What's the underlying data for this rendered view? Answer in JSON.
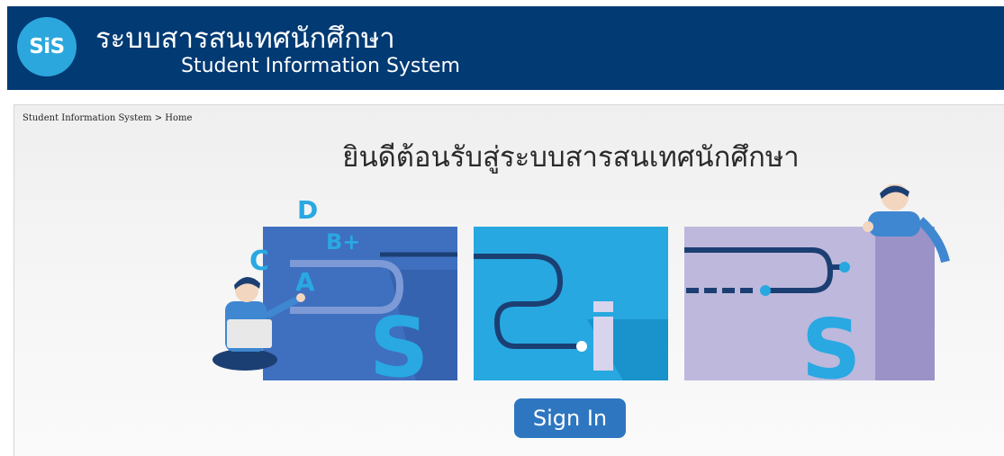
{
  "header": {
    "logo_text": "SiS",
    "title_th": "ระบบสารสนเทศนักศึกษา",
    "title_en": "Student Information System"
  },
  "breadcrumb": "Student Information System > Home",
  "welcome": "ยินดีต้อนรับสู่ระบบสารสนเทศนักศึกษา",
  "banner": {
    "grades": [
      "D",
      "C",
      "B+",
      "A"
    ],
    "colors": {
      "blue_panel": "#3f6fbf",
      "cyan_panel": "#27a8e0",
      "lavender_panel": "#bdb8dc",
      "navy": "#1c3f73"
    }
  },
  "signin_label": "Sign In",
  "colors": {
    "header_bg": "#023a73",
    "button": "#2f76c0"
  }
}
